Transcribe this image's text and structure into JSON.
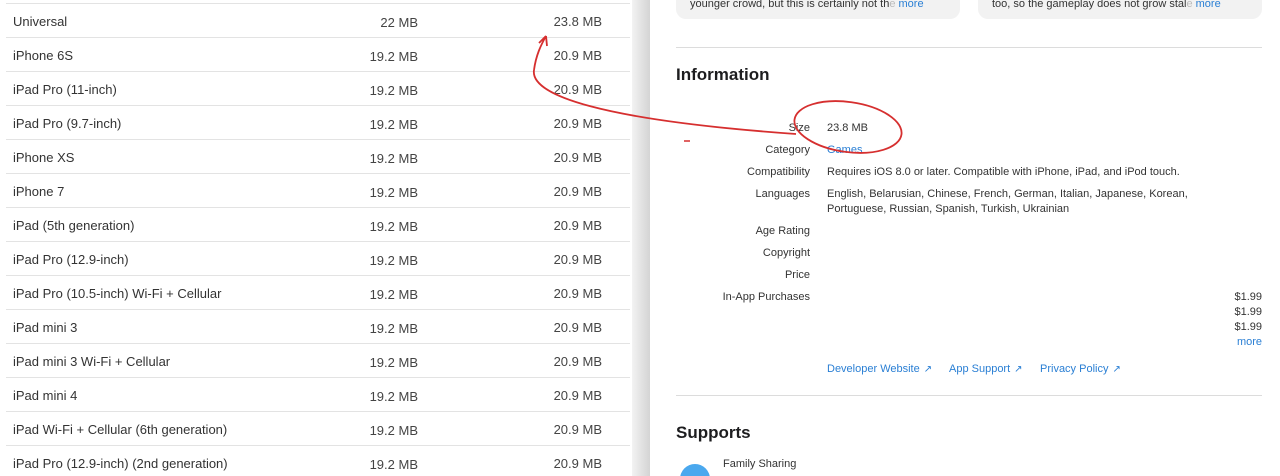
{
  "table": {
    "rows": [
      {
        "device": "Universal",
        "size1": "22 MB",
        "size2": "23.8 MB"
      },
      {
        "device": "iPhone 6S",
        "size1": "19.2 MB",
        "size2": "20.9 MB"
      },
      {
        "device": "iPad Pro (11-inch)",
        "size1": "19.2 MB",
        "size2": "20.9 MB"
      },
      {
        "device": "iPad Pro (9.7-inch)",
        "size1": "19.2 MB",
        "size2": "20.9 MB"
      },
      {
        "device": "iPhone XS",
        "size1": "19.2 MB",
        "size2": "20.9 MB"
      },
      {
        "device": "iPhone 7",
        "size1": "19.2 MB",
        "size2": "20.9 MB"
      },
      {
        "device": "iPad (5th generation)",
        "size1": "19.2 MB",
        "size2": "20.9 MB"
      },
      {
        "device": "iPad Pro (12.9-inch)",
        "size1": "19.2 MB",
        "size2": "20.9 MB"
      },
      {
        "device": "iPad Pro (10.5-inch) Wi-Fi + Cellular",
        "size1": "19.2 MB",
        "size2": "20.9 MB"
      },
      {
        "device": "iPad mini 3",
        "size1": "19.2 MB",
        "size2": "20.9 MB"
      },
      {
        "device": "iPad mini 3 Wi-Fi + Cellular",
        "size1": "19.2 MB",
        "size2": "20.9 MB"
      },
      {
        "device": "iPad mini 4",
        "size1": "19.2 MB",
        "size2": "20.9 MB"
      },
      {
        "device": "iPad Wi-Fi + Cellular (6th generation)",
        "size1": "19.2 MB",
        "size2": "20.9 MB"
      },
      {
        "device": "iPad Pro (12.9-inch) (2nd generation)",
        "size1": "19.2 MB",
        "size2": "20.9 MB"
      }
    ]
  },
  "reviews": {
    "card1_text": "younger crowd, but this is certainly not th",
    "card1_fade": "e",
    "card2_text": "too, so the gameplay does not grow stal",
    "card2_fade": "e",
    "more": "more"
  },
  "information": {
    "title": "Information",
    "size_label": "Size",
    "size_value": "23.8 MB",
    "category_label": "Category",
    "category_value": "Games",
    "compat_label": "Compatibility",
    "compat_value": "Requires iOS 8.0 or later. Compatible with iPhone, iPad, and iPod touch.",
    "languages_label": "Languages",
    "languages_line1": "English, Belarusian, Chinese, French, German, Italian, Japanese, Korean,",
    "languages_line2": "Portuguese, Russian, Spanish, Turkish, Ukrainian",
    "age_label": "Age Rating",
    "copyright_label": "Copyright",
    "price_label": "Price",
    "iap_label": "In-App Purchases",
    "iap_prices": [
      "$1.99",
      "$1.99",
      "$1.99"
    ],
    "iap_more": "more"
  },
  "links": {
    "developer": "Developer Website",
    "support": "App Support",
    "privacy": "Privacy Policy"
  },
  "supports": {
    "title": "Supports",
    "family_sharing": "Family Sharing"
  },
  "colors": {
    "link": "#2a7fd4",
    "annotation": "#d62f2f"
  },
  "icons": [
    "external-link-icon",
    "family-sharing-icon"
  ]
}
